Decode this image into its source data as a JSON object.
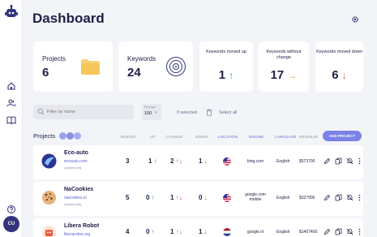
{
  "header": {
    "title": "Dashboard"
  },
  "sidebar": {
    "avatar_initials": "CU"
  },
  "cards": {
    "projects": {
      "label": "Projects",
      "value": "6"
    },
    "keywords": {
      "label": "Keywords",
      "value": "24"
    },
    "moved_up": {
      "label": "Keywords moved up",
      "value": "1",
      "arrow": "↑"
    },
    "no_change": {
      "label": "Keywords without change",
      "value": "17",
      "arrow": "→"
    },
    "moved_down": {
      "label": "Keywords moved down",
      "value": "6",
      "arrow": "↓"
    }
  },
  "toolbar": {
    "search_placeholder": "Filter by name",
    "per_page_label": "Per page",
    "per_page_value": "100",
    "selected_text": "0 selected",
    "select_all_label": "Select all"
  },
  "projects": {
    "title": "Projects",
    "add_button": "ADD PROJECT",
    "columns": [
      "WORDS",
      "UP",
      "CHANGE",
      "DOWN",
      "LOCATION",
      "ENGINE",
      "LANGUAGE",
      "REVENUE"
    ],
    "rows": [
      {
        "name": "Eco-auto",
        "link": "ecoauto.com",
        "date": "Updated daily",
        "words": "3",
        "up": "1",
        "change": "2",
        "down": "1",
        "engine": "bing.com",
        "engine2": "",
        "language": "English",
        "revenue": "$573700"
      },
      {
        "name": "NaCookies",
        "link": "nacookies.io",
        "date": "Updated daily",
        "words": "5",
        "up": "0",
        "change": "1",
        "down": "0",
        "engine": "google.com",
        "engine2": "mobile",
        "language": "English",
        "revenue": "$327900"
      },
      {
        "name": "Libera Robot",
        "link": "liberarobot.org",
        "date": "",
        "words": "4",
        "up": "0",
        "change": "1",
        "down": "1",
        "engine": "google.nl",
        "engine2": "",
        "language": "English",
        "revenue": "$1407400"
      }
    ]
  },
  "colors": {
    "accent": "#7a82e6",
    "up": "#2aa56b",
    "flat": "#e8a13a",
    "down": "#d94848"
  }
}
